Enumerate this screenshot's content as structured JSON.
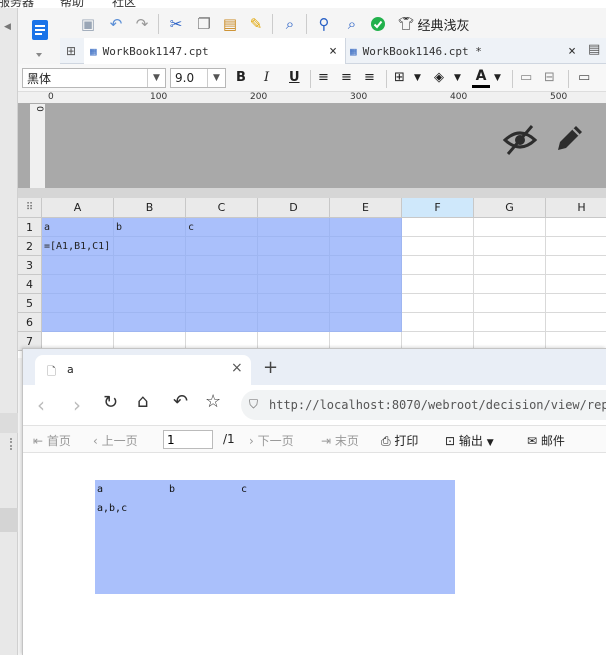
{
  "menubar": {
    "items": [
      "服务器",
      "帮助",
      "社区"
    ]
  },
  "toolbar": {
    "classic_gray": "经典浅灰"
  },
  "tabs": [
    {
      "label": "WorkBook1147.cpt",
      "close": "×"
    },
    {
      "label": "WorkBook1146.cpt *",
      "close": "×"
    }
  ],
  "format": {
    "font_name": "黑体",
    "font_size": "9.0",
    "bold": "B",
    "italic": "I",
    "underline": "U",
    "font_color_label": "A"
  },
  "ruler": {
    "marks": [
      "0",
      "100",
      "200",
      "300",
      "400",
      "500"
    ],
    "vmark": "0"
  },
  "grid": {
    "columns": [
      "A",
      "B",
      "C",
      "D",
      "E",
      "F",
      "G",
      "H"
    ],
    "rows": [
      "1",
      "2",
      "3",
      "4",
      "5",
      "6",
      "7"
    ],
    "cells": {
      "A1": "a",
      "B1": "b",
      "C1": "c",
      "A2": "=[A1,B1,C1]"
    }
  },
  "browser": {
    "tab_title": "a",
    "tab_close": "×",
    "new_tab": "+",
    "url": "http://localhost:8070/webroot/decision/view/repo",
    "url_host": "localhost"
  },
  "pager": {
    "first": "首页",
    "prev": "上一页",
    "page_value": "1",
    "total": "/1",
    "next": "下一页",
    "last": "末页",
    "print": "打印",
    "export": "输出",
    "email": "邮件"
  },
  "report": {
    "row1": [
      "a",
      "b",
      "c"
    ],
    "row2": "a,b,c"
  },
  "colors": {
    "selection": "#aac0fb",
    "accent": "#1a73e8",
    "active_col": "#cfe8fb"
  }
}
